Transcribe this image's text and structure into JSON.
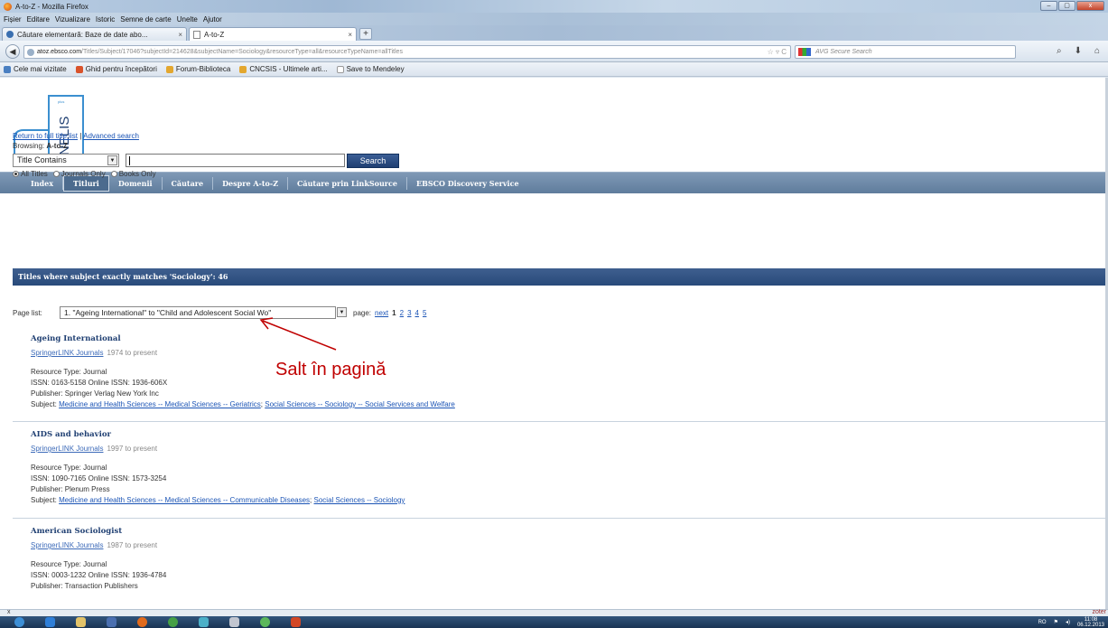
{
  "window": {
    "title": "A-to-Z - Mozilla Firefox",
    "controls": [
      "–",
      "▢",
      "x"
    ]
  },
  "menu": [
    "Fișier",
    "Editare",
    "Vizualizare",
    "Istoric",
    "Semne de carte",
    "Unelte",
    "Ajutor"
  ],
  "tabs": [
    {
      "label": "Căutare elementară: Baze de date abo...",
      "close": "×"
    },
    {
      "label": "A-to-Z",
      "close": "×"
    }
  ],
  "new_tab": "+",
  "address": {
    "host": "atoz.ebsco.com",
    "path": "/Titles/Subject/17046?subjectId=214628&subjectName=Sociology&resourceType=all&resourceTypeName=allTitles",
    "star": "☆ ▿ C"
  },
  "search_engine": {
    "placeholder": "AVG Secure Search"
  },
  "bookmarks": [
    {
      "label": "Cele mai vizitate",
      "color": "#4a7fc1"
    },
    {
      "label": "Ghid pentru începători",
      "color": "#d9532b"
    },
    {
      "label": "Forum-Biblioteca",
      "color": "#e3a72f"
    },
    {
      "label": "CNCSIS - Ultimele arti...",
      "color": "#e3a72f"
    },
    {
      "label": "Save to Mendeley",
      "color": "#dddddd"
    }
  ],
  "logo": {
    "text": "ANELIS",
    "small": "plus"
  },
  "site_nav": [
    {
      "label": "Index",
      "active": false
    },
    {
      "label": "Titluri",
      "active": true
    },
    {
      "label": "Domenii",
      "active": false
    },
    {
      "label": "Căutare",
      "active": false
    },
    {
      "label": "Despre A-to-Z",
      "active": false
    },
    {
      "label": "Căutare prin LinkSource",
      "active": false
    },
    {
      "label": "EBSCO Discovery Service",
      "active": false
    }
  ],
  "search": {
    "return_link": "Return to full title list",
    "separator": "|",
    "advanced_link": "Advanced search",
    "browsing_label": "Browsing:",
    "browsing_value": "A-to-Z",
    "mode": "Title Contains",
    "query": "",
    "button": "Search",
    "filters": [
      {
        "label": "All Titles",
        "checked": true
      },
      {
        "label": "Journals Only",
        "checked": false
      },
      {
        "label": "Books Only",
        "checked": false
      }
    ]
  },
  "results_header": "Titles where subject exactly matches 'Sociology': 46",
  "pagination": {
    "label": "Page list:",
    "selected": "1. \"Ageing International\" to \"Child and Adolescent Social Wo\"",
    "page_label": "page:",
    "next": "next",
    "current": "1",
    "pages": [
      "2",
      "3",
      "4",
      "5"
    ]
  },
  "records": [
    {
      "title": "Ageing International",
      "source": "SpringerLINK Journals",
      "coverage": "1974 to present",
      "type": "Resource Type: Journal",
      "issn": "ISSN: 0163-5158 Online ISSN: 1936-606X",
      "publisher": "Publisher: Springer Verlag New York Inc",
      "subject_label": "Subject:",
      "subjects": [
        "Medicine and Health Sciences -- Medical Sciences -- Geriatrics",
        "Social Sciences -- Sociology -- Social Services and Welfare"
      ]
    },
    {
      "title": "AIDS and behavior",
      "source": "SpringerLINK Journals",
      "coverage": "1997 to present",
      "type": "Resource Type: Journal",
      "issn": "ISSN: 1090-7165 Online ISSN: 1573-3254",
      "publisher": "Publisher: Plenum Press",
      "subject_label": "Subject:",
      "subjects": [
        "Medicine and Health Sciences -- Medical Sciences -- Communicable Diseases",
        "Social Sciences -- Sociology"
      ]
    },
    {
      "title": "American Sociologist",
      "source": "SpringerLINK Journals",
      "coverage": "1987 to present",
      "type": "Resource Type: Journal",
      "issn": "ISSN: 0003-1232 Online ISSN: 1936-4784",
      "publisher": "Publisher: Transaction Publishers"
    }
  ],
  "annotation": "Salt în pagină",
  "annotation_color": "#c00000",
  "statusbar": {
    "close": "x",
    "zotero": "zoter"
  },
  "taskbar": {
    "apps": [
      {
        "name": "start-orb",
        "color": "#3d8fd6"
      },
      {
        "name": "internet-explorer",
        "color": "#2f7fd8"
      },
      {
        "name": "file-explorer",
        "color": "#e2c36a"
      },
      {
        "name": "media",
        "color": "#4a6fb0"
      },
      {
        "name": "firefox",
        "color": "#e06a1c"
      },
      {
        "name": "chrome",
        "color": "#46a046"
      },
      {
        "name": "network",
        "color": "#4cb0c8"
      },
      {
        "name": "paint",
        "color": "#c2c6d0"
      },
      {
        "name": "browser",
        "color": "#5cb85c"
      },
      {
        "name": "powerpoint",
        "color": "#d24726"
      }
    ],
    "lang": "RO",
    "time": "11:08",
    "date": "06.12.2013"
  }
}
